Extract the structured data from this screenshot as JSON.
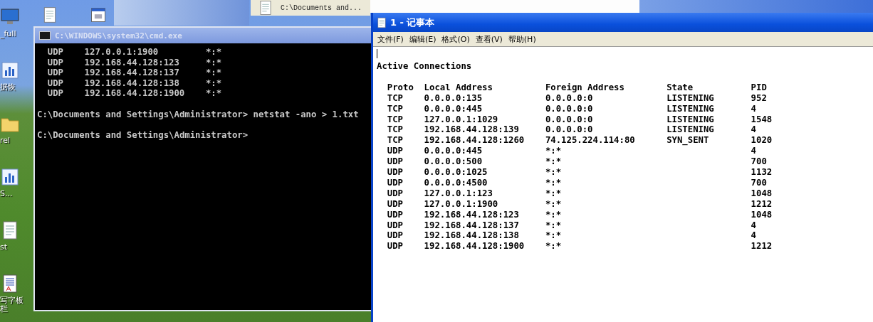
{
  "desktop": {
    "icons": [
      {
        "kind": "monitor",
        "label": "_full"
      },
      {
        "kind": "chart",
        "label": "据恢"
      },
      {
        "kind": "folder",
        "label": "rel"
      },
      {
        "kind": "chart",
        "label": "S..."
      },
      {
        "kind": "document",
        "label": "st"
      },
      {
        "kind": "notepad",
        "label": "写字板栏"
      }
    ],
    "top_icons": [
      {
        "kind": "document"
      },
      {
        "kind": "window"
      }
    ],
    "background_window": {
      "text": "C:\\Documents and..."
    }
  },
  "console": {
    "title": "C:\\WINDOWS\\system32\\cmd.exe",
    "lines": [
      {
        "kind": "row",
        "cells": [
          "UDP",
          "127.0.0.1:1900",
          "*:*"
        ]
      },
      {
        "kind": "row",
        "cells": [
          "UDP",
          "192.168.44.128:123",
          "*:*"
        ]
      },
      {
        "kind": "row",
        "cells": [
          "UDP",
          "192.168.44.128:137",
          "*:*"
        ]
      },
      {
        "kind": "row",
        "cells": [
          "UDP",
          "192.168.44.128:138",
          "*:*"
        ]
      },
      {
        "kind": "row",
        "cells": [
          "UDP",
          "192.168.44.128:1900",
          "*:*"
        ]
      },
      {
        "kind": "prompt",
        "text": "C:\\Documents and Settings\\Administrator> netstat -ano > 1.txt"
      },
      {
        "kind": "prompt",
        "text": "C:\\Documents and Settings\\Administrator>"
      }
    ]
  },
  "notepad": {
    "title": "1 - 记事本",
    "menu": [
      "文件(F)",
      "编辑(E)",
      "格式(O)",
      "查看(V)",
      "帮助(H)"
    ],
    "heading": "Active Connections",
    "columns": [
      "Proto",
      "Local Address",
      "Foreign Address",
      "State",
      "PID"
    ],
    "rows": [
      [
        "TCP",
        "0.0.0.0:135",
        "0.0.0.0:0",
        "LISTENING",
        "952"
      ],
      [
        "TCP",
        "0.0.0.0:445",
        "0.0.0.0:0",
        "LISTENING",
        "4"
      ],
      [
        "TCP",
        "127.0.0.1:1029",
        "0.0.0.0:0",
        "LISTENING",
        "1548"
      ],
      [
        "TCP",
        "192.168.44.128:139",
        "0.0.0.0:0",
        "LISTENING",
        "4"
      ],
      [
        "TCP",
        "192.168.44.128:1260",
        "74.125.224.114:80",
        "SYN_SENT",
        "1020"
      ],
      [
        "UDP",
        "0.0.0.0:445",
        "*:*",
        "",
        "4"
      ],
      [
        "UDP",
        "0.0.0.0:500",
        "*:*",
        "",
        "700"
      ],
      [
        "UDP",
        "0.0.0.0:1025",
        "*:*",
        "",
        "1132"
      ],
      [
        "UDP",
        "0.0.0.0:4500",
        "*:*",
        "",
        "700"
      ],
      [
        "UDP",
        "127.0.0.1:123",
        "*:*",
        "",
        "1048"
      ],
      [
        "UDP",
        "127.0.0.1:1900",
        "*:*",
        "",
        "1212"
      ],
      [
        "UDP",
        "192.168.44.128:123",
        "*:*",
        "",
        "1048"
      ],
      [
        "UDP",
        "192.168.44.128:137",
        "*:*",
        "",
        "4"
      ],
      [
        "UDP",
        "192.168.44.128:138",
        "*:*",
        "",
        "4"
      ],
      [
        "UDP",
        "192.168.44.128:1900",
        "*:*",
        "",
        "1212"
      ]
    ]
  }
}
